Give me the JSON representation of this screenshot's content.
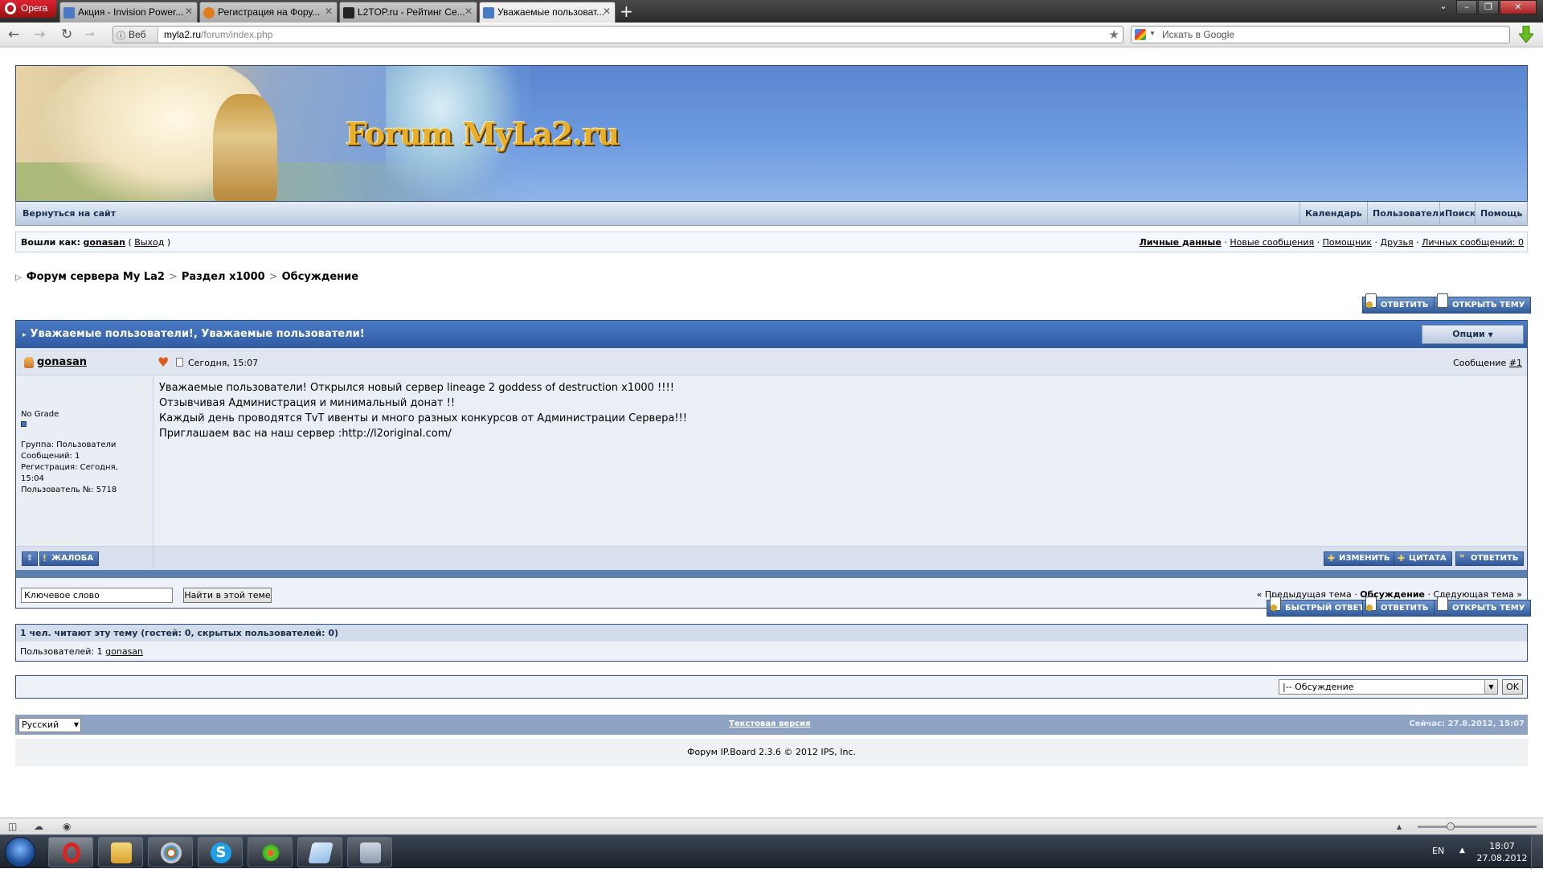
{
  "browser": {
    "opera_label": "Opera",
    "tabs": [
      {
        "title": "Акция - Invision Power...",
        "icon_color": "#4a78c8"
      },
      {
        "title": "Регистрация на Фору...",
        "icon_color": "#e07b1a"
      },
      {
        "title": "L2TOP.ru - Рейтинг Се...",
        "icon_color": "#222222"
      },
      {
        "title": "Уважаемые пользоват...",
        "icon_color": "#4a78c8"
      }
    ],
    "new_tab_symbol": "+",
    "url_badge": "Веб",
    "url_domain": "myla2.ru",
    "url_path": "/forum/index.php",
    "search_placeholder": "Искать в Google"
  },
  "forum": {
    "logo_text": "Forum MyLa2.ru",
    "back_to_site": "Вернуться на сайт",
    "top_nav": [
      "Календарь",
      "Пользователи",
      "Поиск",
      "Помощь"
    ],
    "logged_in_as": "Вошли как:",
    "username": "gonasan",
    "logout": "Выход",
    "user_links": [
      "Личные данные",
      "Новые сообщения",
      "Помощник",
      "Друзья",
      "Личных сообщений: 0"
    ],
    "breadcrumb": [
      "Форум сервера My La2",
      "Раздел x1000",
      "Обсуждение"
    ],
    "buttons": {
      "reply": "ОТВЕТИТЬ",
      "new_topic": "ОТКРЫТЬ ТЕМУ",
      "quick_reply": "БЫСТРЫЙ ОТВЕТ",
      "edit": "ИЗМЕНИТЬ",
      "quote": "ЦИТАТА",
      "report": "ЖАЛОБА"
    },
    "topic_title": "Уважаемые пользователи!, Уважаемые пользователи!",
    "options_label": "Опции",
    "post": {
      "author": "gonasan",
      "date": "Сегодня, 15:07",
      "number_label": "Сообщение",
      "number": "#1",
      "grade": "No Grade",
      "group": "Группа: Пользователи",
      "posts": "Сообщений: 1",
      "registered": "Регистрация: Сегодня, 15:04",
      "member_no": "Пользователь №: 5718",
      "body": [
        "Уважаемые пользователи! Открылся новый сервер lineage 2 goddess of destruction x1000 !!!!",
        "Отзывчивая Администрация и минимальный донат !!",
        "Каждый день проводятся TvT ивенты и много разных конкурсов от Администрации Сервера!!!",
        "Приглашаем вас на наш сервер :http://l2original.com/"
      ]
    },
    "search_keyword_placeholder": "Ключевое слово",
    "search_in_topic": "Найти в этой теме",
    "topic_nav": {
      "prev": "« Предыдущая тема",
      "current": "Обсуждение",
      "next": "Следующая тема »"
    },
    "readers_header": "1 чел. читают эту тему (гостей: 0, скрытых пользователей: 0)",
    "readers_users_label": "Пользователей: 1",
    "readers_user": "gonasan",
    "jump_selected": "|-- Обсуждение",
    "jump_ok": "OK",
    "language": "Русский",
    "lofi": "Текстовая версия",
    "now": "Сейчас: 27.8.2012, 15:07",
    "copyright": "Форум IP.Board 2.3.6 © 2012  IPS, Inc."
  },
  "taskbar": {
    "lang": "EN",
    "time": "18:07",
    "date": "27.08.2012"
  },
  "colors": {
    "accent": "#2e5aa1",
    "header_blue": "#6d9be0",
    "taskbar": "#1b222c"
  }
}
